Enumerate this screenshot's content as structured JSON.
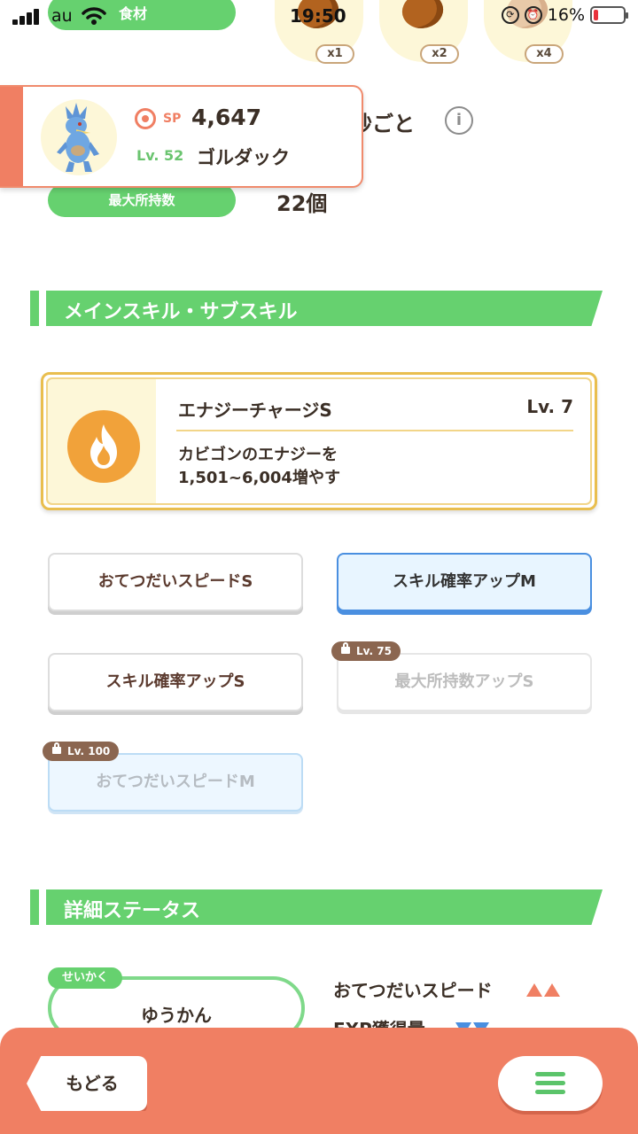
{
  "status_bar": {
    "carrier": "au",
    "time": "19:50",
    "battery_percent": "16%",
    "battery_level": 0.16
  },
  "ingredients": {
    "pill_label": "食材",
    "items": [
      {
        "icon": "cocoa-icon",
        "count": "x1"
      },
      {
        "icon": "cocoa-icon",
        "count": "x2"
      },
      {
        "icon": "cocoa-icon",
        "count": "x4"
      }
    ]
  },
  "help_interval_suffix": "秒ごと",
  "pokemon": {
    "sp_label": "SP",
    "sp_value": "4,647",
    "level_label": "Lv. 52",
    "name": "ゴルダック"
  },
  "max_carry": {
    "label": "最大所持数",
    "value": "22個"
  },
  "sections": {
    "skills_title": "メインスキル・サブスキル",
    "status_title": "詳細ステータス"
  },
  "main_skill": {
    "name": "エナジーチャージS",
    "level": "Lv. 7",
    "description": "カビゴンのエナジーを\n1,501~6,004増やす",
    "icon": "fire-icon",
    "icon_color": "#f1a23a"
  },
  "sub_skills": [
    {
      "label": "おてつだいスピードS",
      "state": "normal"
    },
    {
      "label": "スキル確率アップM",
      "state": "active"
    },
    {
      "label": "スキル確率アップS",
      "state": "normal"
    },
    {
      "label": "最大所持数アップS",
      "state": "locked",
      "unlock": "Lv. 75"
    },
    {
      "label": "おてつだいスピードM",
      "state": "locked",
      "unlock": "Lv. 100"
    }
  ],
  "nature": {
    "tag": "せいかく",
    "value": "ゆうかん",
    "effects": [
      {
        "label": "おてつだいスピード",
        "direction": "up"
      },
      {
        "label": "EXP獲得量",
        "direction": "down"
      }
    ]
  },
  "bottom_bar": {
    "back_label": "もどる",
    "menu_icon": "hamburger-menu-icon"
  },
  "colors": {
    "accent_green": "#66d16f",
    "accent_orange": "#f07f63",
    "highlight_blue": "#4a8fe0",
    "gold_border": "#e9be4e"
  }
}
